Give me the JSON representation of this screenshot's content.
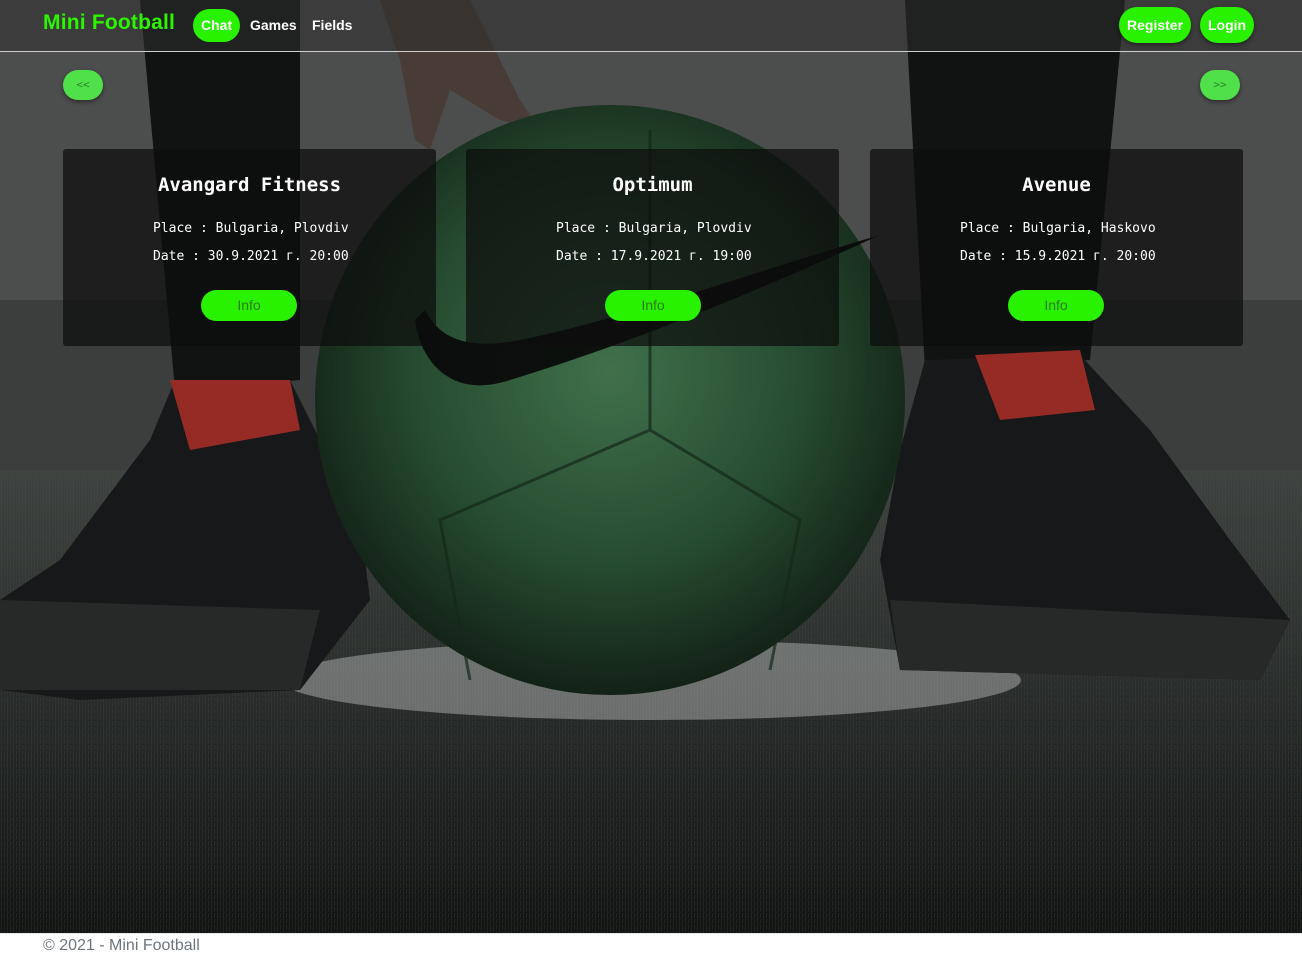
{
  "navbar": {
    "brand": "Mini Football",
    "links": [
      {
        "label": "Chat",
        "active": true
      },
      {
        "label": "Games",
        "active": false
      },
      {
        "label": "Fields",
        "active": false
      }
    ],
    "register_label": "Register",
    "login_label": "Login"
  },
  "pager": {
    "prev_label": "<<",
    "next_label": ">>"
  },
  "cards": [
    {
      "title": "Avangard Fitness",
      "place": "Place : Bulgaria, Plovdiv",
      "date": "Date : 30.9.2021 г. 20:00",
      "button": "Info"
    },
    {
      "title": "Optimum",
      "place": "Place : Bulgaria, Plovdiv",
      "date": "Date : 17.9.2021 г. 19:00",
      "button": "Info"
    },
    {
      "title": "Avenue",
      "place": "Place : Bulgaria, Haskovo",
      "date": "Date : 15.9.2021 г. 20:00",
      "button": "Info"
    }
  ],
  "footer": {
    "text": "© 2021 - Mini Football"
  },
  "colors": {
    "accent": "#29f200",
    "brand": "#2cf500",
    "card_bg": "#0c0c0c"
  },
  "background": {
    "icon": "football-photo"
  }
}
